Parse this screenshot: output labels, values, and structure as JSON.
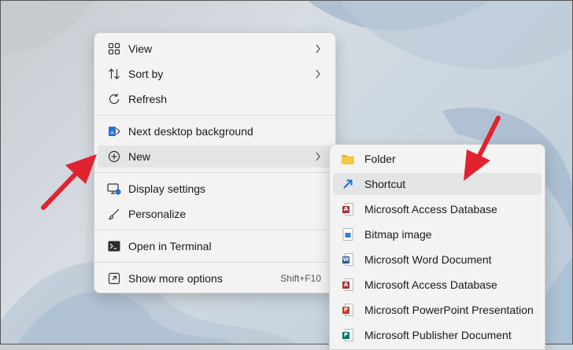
{
  "context_menu": {
    "items": [
      {
        "label": "View",
        "icon": "grid-icon",
        "submenu": true
      },
      {
        "label": "Sort by",
        "icon": "sort-icon",
        "submenu": true
      },
      {
        "label": "Refresh",
        "icon": "refresh-icon"
      },
      {
        "label": "Next desktop background",
        "icon": "next-background-icon"
      },
      {
        "label": "New",
        "icon": "plus-circle-icon",
        "submenu": true,
        "highlighted": true
      },
      {
        "label": "Display settings",
        "icon": "display-settings-icon"
      },
      {
        "label": "Personalize",
        "icon": "brush-icon"
      },
      {
        "label": "Open in Terminal",
        "icon": "terminal-icon"
      },
      {
        "label": "Show more options",
        "icon": "show-more-icon",
        "shortcut": "Shift+F10"
      }
    ]
  },
  "new_submenu": {
    "items": [
      {
        "label": "Folder",
        "icon": "folder-icon"
      },
      {
        "label": "Shortcut",
        "icon": "shortcut-icon",
        "highlighted": true
      },
      {
        "label": "Microsoft Access Database",
        "icon": "access-icon"
      },
      {
        "label": "Bitmap image",
        "icon": "bitmap-icon"
      },
      {
        "label": "Microsoft Word Document",
        "icon": "word-icon"
      },
      {
        "label": "Microsoft Access Database",
        "icon": "access-icon"
      },
      {
        "label": "Microsoft PowerPoint Presentation",
        "icon": "powerpoint-icon"
      },
      {
        "label": "Microsoft Publisher Document",
        "icon": "publisher-icon"
      }
    ]
  },
  "colors": {
    "annotation_arrow": "#e0242f",
    "highlight": "#e2e4e6",
    "access": "#a4373a",
    "word": "#2b579a",
    "powerpoint": "#c43e1c",
    "publisher": "#077568",
    "folder": "#f8c93f"
  }
}
